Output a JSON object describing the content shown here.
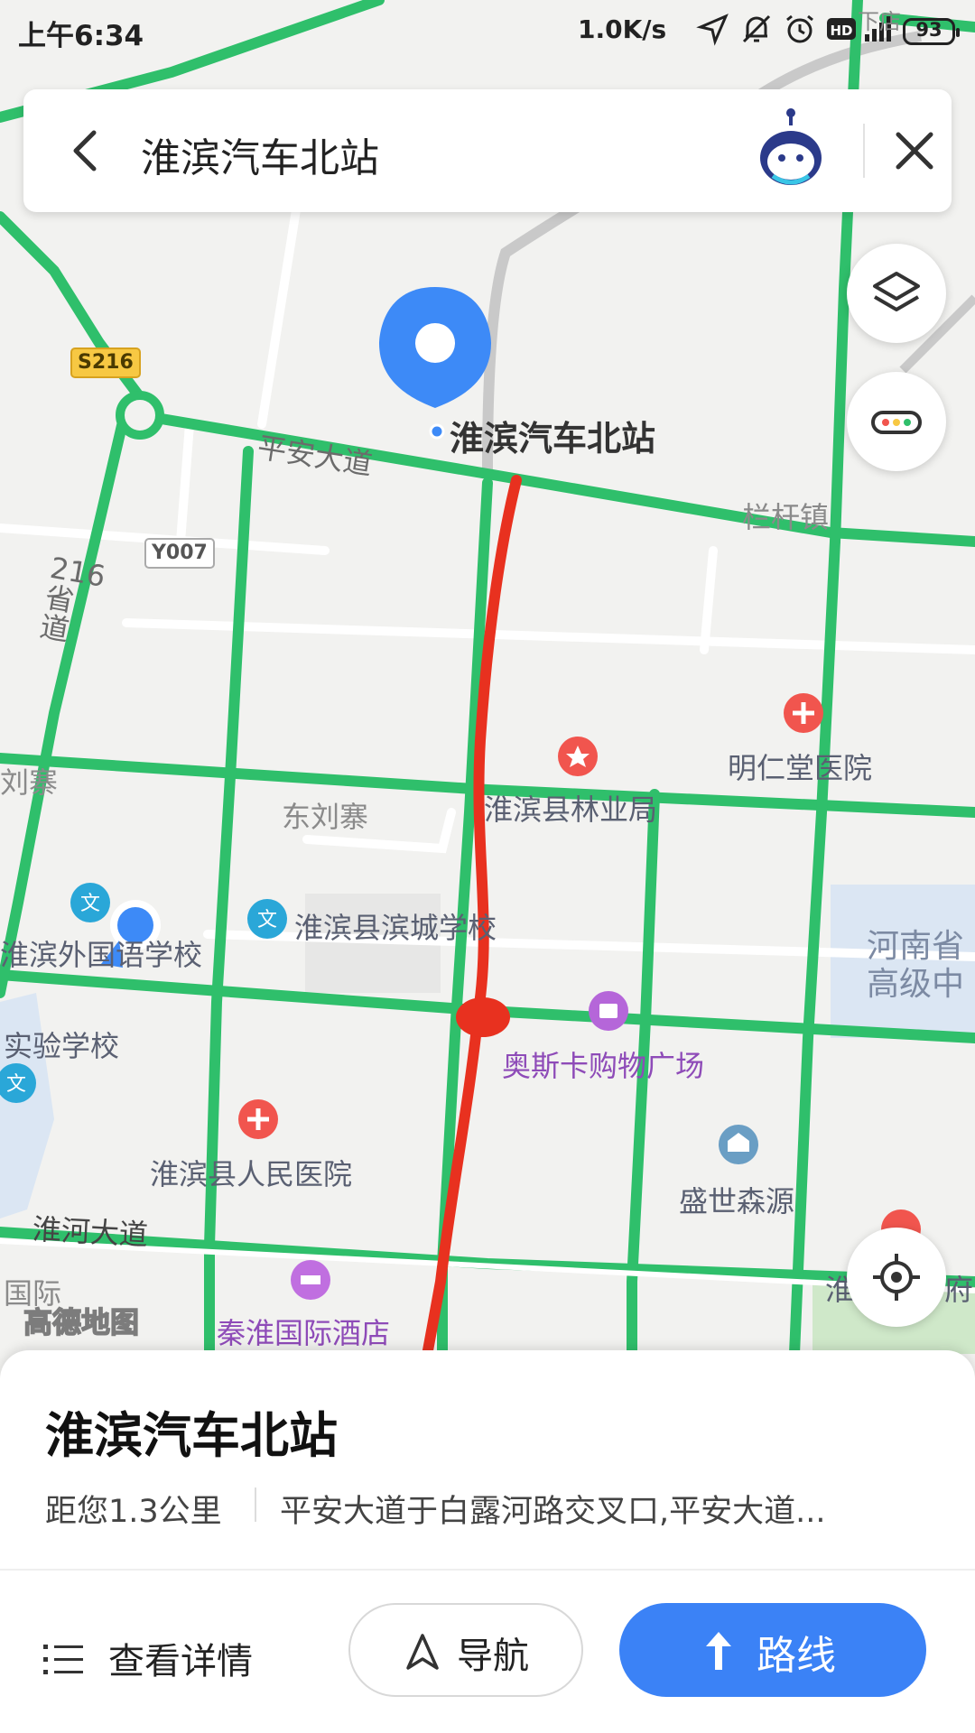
{
  "status_bar": {
    "time": "上午6:34",
    "network_speed": "1.0K/s",
    "battery": "93",
    "corner_text": "下店"
  },
  "search": {
    "query": "淮滨汽车北站"
  },
  "map": {
    "road_labels": {
      "pingan": "平安大道",
      "huaihe": "淮河大道",
      "provincial_216": "216省道"
    },
    "shields": {
      "s216": "S216",
      "y007": "Y007"
    },
    "place_labels": {
      "destination": "淮滨汽车北站",
      "langan": "栏杆镇",
      "liuzhai": "刘寨",
      "dongliuzhai": "东刘寨",
      "mingrentang": "明仁堂医院",
      "forestry": "淮滨县林业局",
      "waiguoyu": "淮滨外国语学校",
      "bincheng": "淮滨县滨城学校",
      "henan_court": "河南省\n高级中",
      "shiyan": "实验学校",
      "aosika": "奥斯卡购物广场",
      "hospital": "淮滨县人民医院",
      "shengshi": "盛世森源",
      "guoji": "国际",
      "qinhuai": "秦淮国际酒店",
      "huai_right": "淮",
      "fu_right": "府"
    },
    "logo": "高德地图",
    "colors": {
      "road_green": "#2fbf6b",
      "marker_blue": "#3d8af7",
      "annotation_red": "#e8311f",
      "poi_red": "#f1554e",
      "shop_purple": "#b566d9",
      "water_blue": "#dbe6f3"
    }
  },
  "controls": {
    "layers_icon": "layers-icon",
    "traffic_icon": "traffic-icon",
    "locate_icon": "locate-icon"
  },
  "place_card": {
    "name": "淮滨汽车北站",
    "distance": "距您1.3公里",
    "address": "平安大道于白露河路交叉口,平安大道..."
  },
  "actions": {
    "details": "查看详情",
    "navigate": "导航",
    "route": "路线"
  }
}
